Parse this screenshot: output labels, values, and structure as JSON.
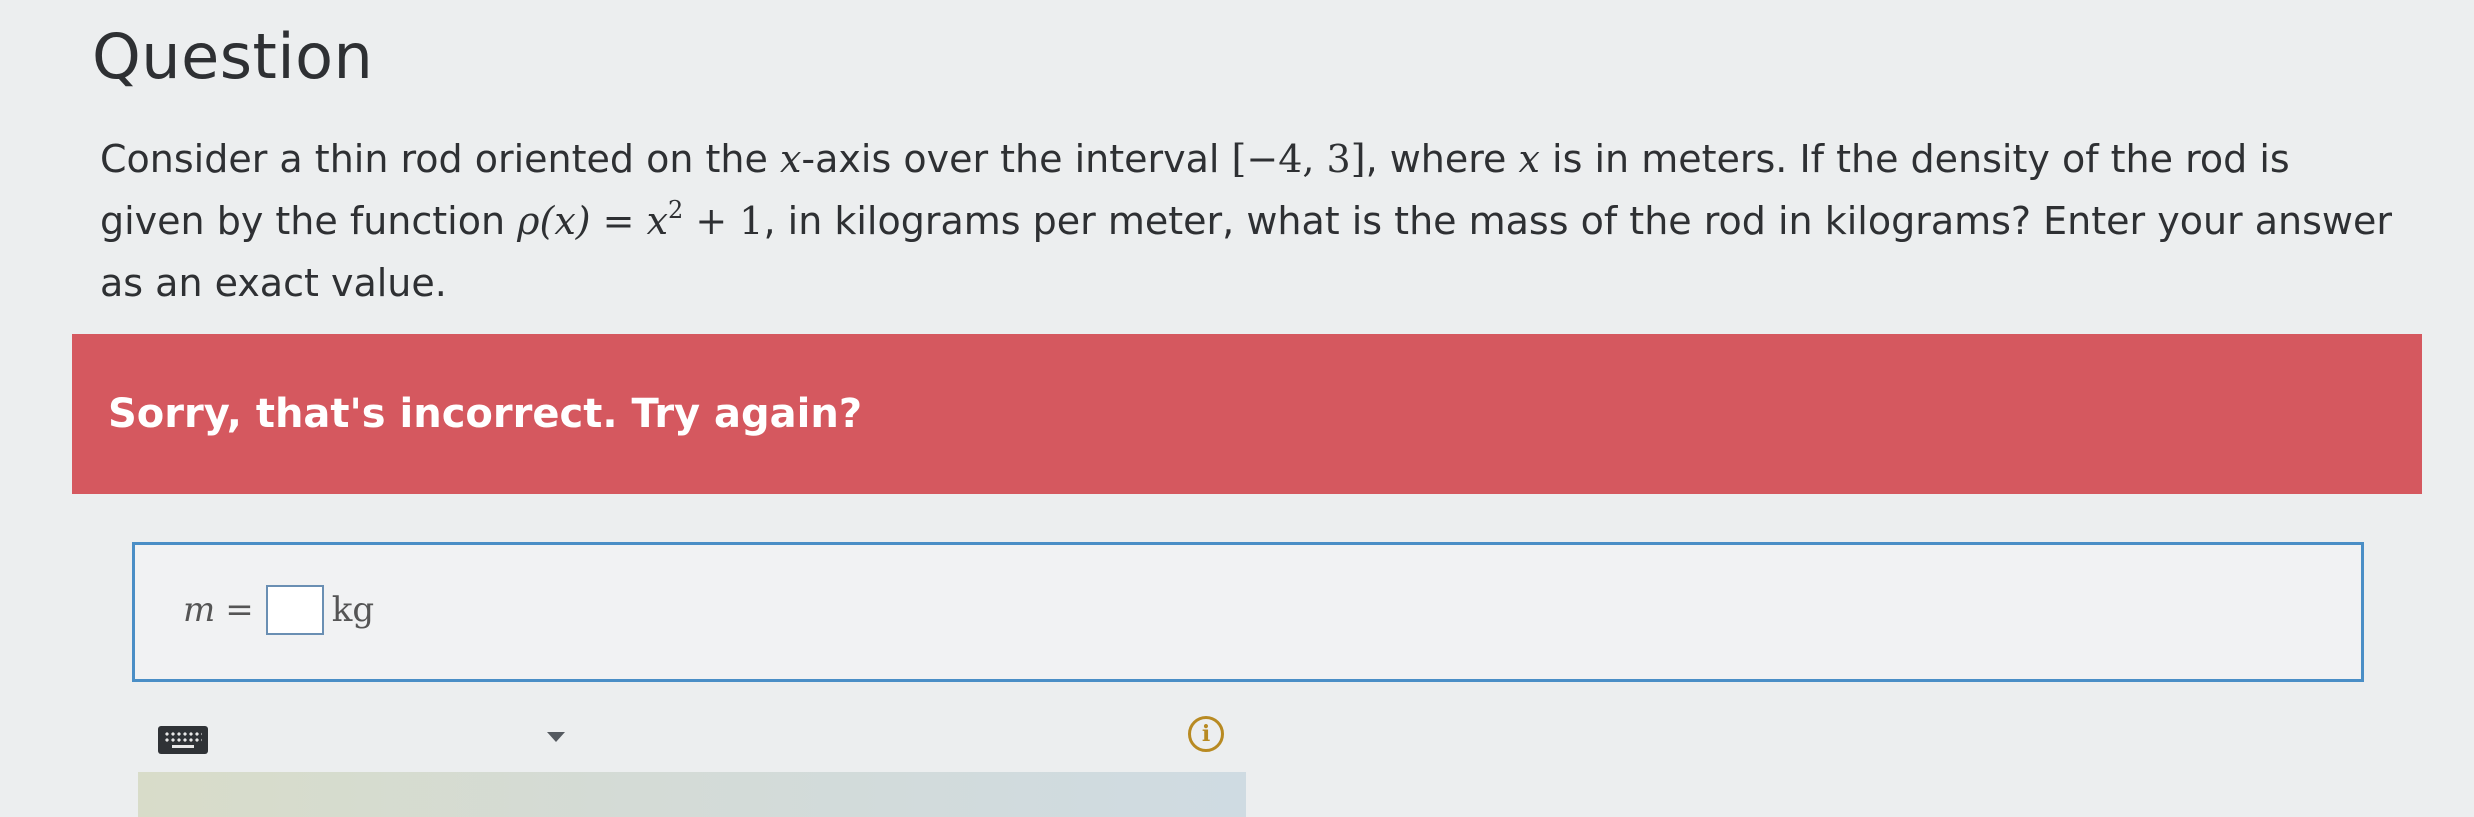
{
  "page": {
    "title": "Question"
  },
  "question": {
    "part1": "Consider a thin rod oriented on the ",
    "var_x": "x",
    "part2": "-axis over the interval ",
    "interval": "[−4, 3]",
    "part3": ", where ",
    "var_x2": "x",
    "part4": " is in meters. If the density of the rod is given by the function ",
    "func_lhs": "ρ(x) = x",
    "exponent": "2",
    "func_rhs": " + 1",
    "part5": ", in kilograms per meter, what is the mass of the rod in kilograms? Enter your answer as an exact value."
  },
  "feedback": {
    "message": "Sorry, that's incorrect. Try again?",
    "color": "#d5585f"
  },
  "answer": {
    "variable": "m",
    "equals": "=",
    "value": "",
    "unit": "kg",
    "border_color": "#4a8ec6"
  },
  "toolbar": {
    "keyboard_icon": "keyboard-icon",
    "dropdown_icon": "chevron-down-icon",
    "info_icon": "info-icon",
    "info_glyph": "i",
    "info_color": "#b88a22"
  }
}
